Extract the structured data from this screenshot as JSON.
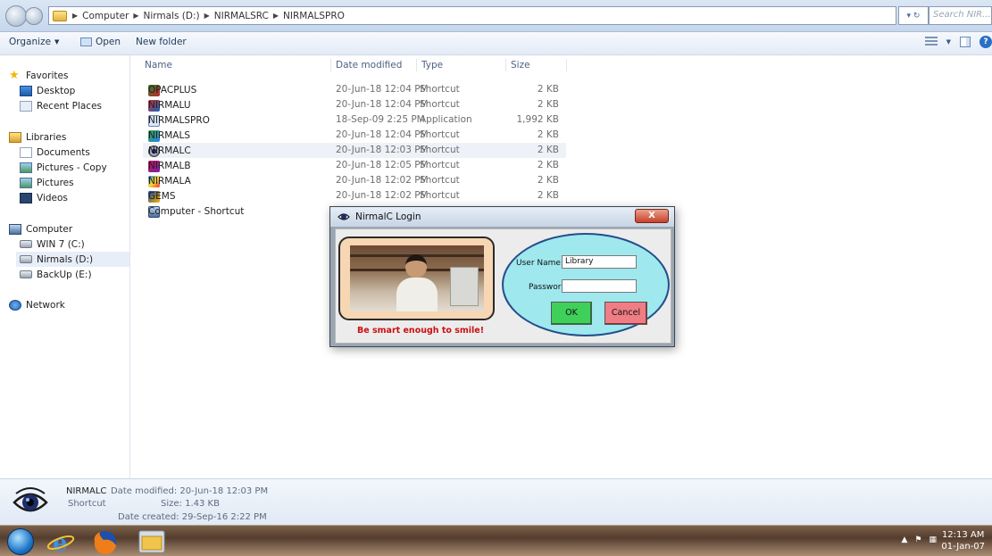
{
  "address_bar": {
    "crumbs": [
      "Computer",
      "Nirmals (D:)",
      "NIRMALSRC",
      "NIRMALSPRO"
    ],
    "search_placeholder": "Search NIR..."
  },
  "command_bar": {
    "organize": "Organize",
    "open": "Open",
    "new_folder": "New folder"
  },
  "nav_pane": {
    "favorites": "Favorites",
    "desktop": "Desktop",
    "recent_places": "Recent Places",
    "libraries": "Libraries",
    "documents": "Documents",
    "pictures_copy": "Pictures - Copy",
    "pictures": "Pictures",
    "videos": "Videos",
    "computer": "Computer",
    "drive_c": "WIN 7 (C:)",
    "drive_d": "Nirmals (D:)",
    "drive_e": "BackUp (E:)",
    "network": "Network"
  },
  "columns": {
    "name": "Name",
    "date": "Date modified",
    "type": "Type",
    "size": "Size"
  },
  "files": [
    {
      "name": "OPACPLUS",
      "date": "20-Jun-18 12:04 PM",
      "type": "Shortcut",
      "size": "2 KB"
    },
    {
      "name": "NIRMALU",
      "date": "20-Jun-18 12:04 PM",
      "type": "Shortcut",
      "size": "2 KB"
    },
    {
      "name": "NIRMALSPRO",
      "date": "18-Sep-09 2:25 PM",
      "type": "Application",
      "size": "1,992 KB"
    },
    {
      "name": "NIRMALS",
      "date": "20-Jun-18 12:04 PM",
      "type": "Shortcut",
      "size": "2 KB"
    },
    {
      "name": "NIRMALC",
      "date": "20-Jun-18 12:03 PM",
      "type": "Shortcut",
      "size": "2 KB"
    },
    {
      "name": "NIRMALB",
      "date": "20-Jun-18 12:05 PM",
      "type": "Shortcut",
      "size": "2 KB"
    },
    {
      "name": "NIRMALA",
      "date": "20-Jun-18 12:02 PM",
      "type": "Shortcut",
      "size": "2 KB"
    },
    {
      "name": "GEMS",
      "date": "20-Jun-18 12:02 PM",
      "type": "Shortcut",
      "size": "2 KB"
    },
    {
      "name": "Computer - Shortcut",
      "date": "",
      "type": "",
      "size": ""
    }
  ],
  "details": {
    "name": "NIRMALC",
    "date_modified": "Date modified: 20-Jun-18 12:03 PM",
    "type": "Shortcut",
    "size": "Size: 1.43 KB",
    "date_created": "Date created: 29-Sep-16 2:22 PM"
  },
  "dialog": {
    "title": "NirmalC Login",
    "close": "X",
    "slogan": "Be smart enough to smile!",
    "username_label": "User Name:",
    "username_value": "Library",
    "password_label": "Password:",
    "password_value": "",
    "ok": "OK",
    "cancel": "Cancel"
  },
  "taskbar": {
    "time": "12:13 AM",
    "date": "01-Jan-07"
  }
}
